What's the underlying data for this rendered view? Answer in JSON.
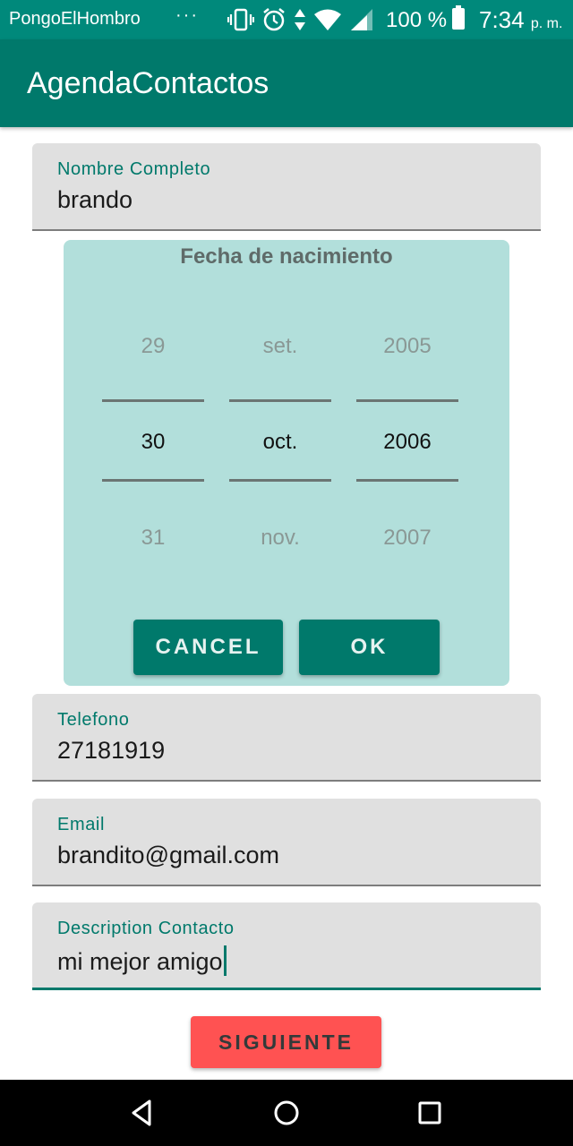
{
  "status_bar": {
    "carrier": "PongoElHombro",
    "overflow": "···",
    "battery": "100 %",
    "time": "7:34",
    "ampm": "p. m."
  },
  "app_bar": {
    "title": "AgendaContactos"
  },
  "fields": {
    "nombre": {
      "label": "Nombre Completo",
      "value": "brando"
    },
    "telefono": {
      "label": "Telefono",
      "value": "27181919"
    },
    "email": {
      "label": "Email",
      "value": "brandito@gmail.com"
    },
    "descripcion": {
      "label": "Description Contacto",
      "value": "mi mejor amigo"
    }
  },
  "date_picker": {
    "title": "Fecha de nacimiento",
    "day": {
      "prev": "29",
      "current": "30",
      "next": "31"
    },
    "month": {
      "prev": "set.",
      "current": "oct.",
      "next": "nov."
    },
    "year": {
      "prev": "2005",
      "current": "2006",
      "next": "2007"
    },
    "cancel_label": "CANCEL",
    "ok_label": "OK"
  },
  "siguiente_label": "SIGUIENTE",
  "nav_bar": {
    "icons": [
      "back-icon",
      "home-icon",
      "recents-icon"
    ]
  },
  "colors": {
    "primary": "#00796b",
    "status_bar": "#00897b",
    "picker_bg": "#b2dfdb",
    "accent_button": "#ff5252"
  }
}
